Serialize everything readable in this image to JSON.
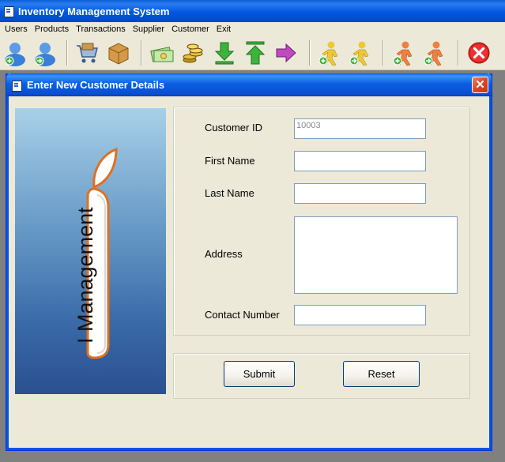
{
  "app": {
    "title": "Inventory Management System"
  },
  "menu": {
    "items": [
      "Users",
      "Products",
      "Transactions",
      "Supplier",
      "Customer",
      "Exit"
    ]
  },
  "toolbar": {
    "icons": [
      "add-user-icon",
      "user-go-icon",
      "shopping-cart-icon",
      "box-icon",
      "money-icon",
      "coins-icon",
      "download-arrow-icon",
      "upload-arrow-icon",
      "right-arrow-icon",
      "add-customer-icon",
      "customer-go-icon",
      "add-supplier-icon",
      "supplier-go-icon",
      "exit-icon"
    ]
  },
  "dialog": {
    "title": "Enter New Customer Details",
    "logo_text": "I Management",
    "form": {
      "customer_id_label": "Customer ID",
      "customer_id_value": "10003",
      "first_name_label": "First Name",
      "first_name_value": "",
      "last_name_label": "Last Name",
      "last_name_value": "",
      "address_label": "Address",
      "address_value": "",
      "contact_label": "Contact Number",
      "contact_value": ""
    },
    "buttons": {
      "submit": "Submit",
      "reset": "Reset"
    }
  },
  "colors": {
    "title_bar": "#0058e0",
    "dialog_bg": "#ece9d8",
    "logo_accent": "#e07020"
  }
}
